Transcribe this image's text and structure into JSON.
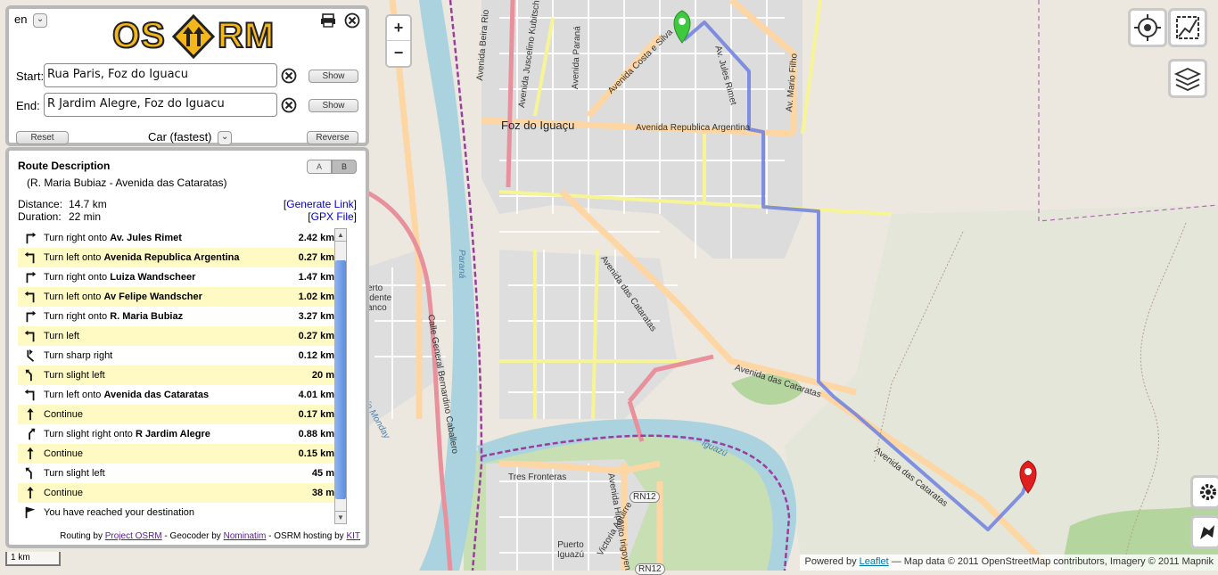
{
  "app": {
    "language": "en",
    "logo_left": "OS",
    "logo_right": "RM"
  },
  "form": {
    "start_label": "Start:",
    "start_value": "Rua Paris, Foz do Iguacu",
    "end_label": "End:",
    "end_value": "R Jardim Alegre, Foz do Iguacu",
    "show_label": "Show",
    "reset_label": "Reset",
    "mode_label": "Car (fastest)",
    "reverse_label": "Reverse"
  },
  "route": {
    "title": "Route Description",
    "from_to": "(R. Maria Bubiaz - Avenida das Cataratas)",
    "alt_a": "A",
    "alt_b": "B",
    "distance_label": "Distance:",
    "distance_value": "14.7 km",
    "duration_label": "Duration:",
    "duration_value": "22 min",
    "generate_link": "Generate Link",
    "gpx_file": "GPX File",
    "steps": [
      {
        "icon": "turn-right-icon",
        "text": "Turn right onto",
        "street": "Av. Jules Rimet",
        "dist": "2.42 km"
      },
      {
        "icon": "turn-left-icon",
        "text": "Turn left onto",
        "street": "Avenida Republica Argentina",
        "dist": "0.27 km"
      },
      {
        "icon": "turn-right-icon",
        "text": "Turn right onto",
        "street": "Luiza Wandscheer",
        "dist": "1.47 km"
      },
      {
        "icon": "turn-left-icon",
        "text": "Turn left onto",
        "street": "Av Felipe Wandscher",
        "dist": "1.02 km"
      },
      {
        "icon": "turn-right-icon",
        "text": "Turn right onto",
        "street": "R. Maria Bubiaz",
        "dist": "3.27 km"
      },
      {
        "icon": "turn-left-icon",
        "text": "Turn left",
        "street": "",
        "dist": "0.27 km"
      },
      {
        "icon": "sharp-right-icon",
        "text": "Turn sharp right",
        "street": "",
        "dist": "0.12 km"
      },
      {
        "icon": "slight-left-icon",
        "text": "Turn slight left",
        "street": "",
        "dist": "20 m"
      },
      {
        "icon": "turn-left-icon",
        "text": "Turn left onto",
        "street": "Avenida das Cataratas",
        "dist": "4.01 km"
      },
      {
        "icon": "continue-icon",
        "text": "Continue",
        "street": "",
        "dist": "0.17 km"
      },
      {
        "icon": "slight-right-icon",
        "text": "Turn slight right onto",
        "street": "R Jardim Alegre",
        "dist": "0.88 km"
      },
      {
        "icon": "continue-icon",
        "text": "Continue",
        "street": "",
        "dist": "0.15 km"
      },
      {
        "icon": "slight-left-icon",
        "text": "Turn slight left",
        "street": "",
        "dist": "45 m"
      },
      {
        "icon": "continue-icon",
        "text": "Continue",
        "street": "",
        "dist": "38 m"
      },
      {
        "icon": "destination-flag-icon",
        "text": "You have reached your destination",
        "street": "",
        "dist": ""
      }
    ],
    "footer_routing": "Routing by",
    "footer_routing_link": "Project OSRM",
    "footer_geocoder": " - Geocoder by",
    "footer_geocoder_link": "Nominatim",
    "footer_hosting": " - OSRM hosting by",
    "footer_hosting_link": "KIT"
  },
  "map": {
    "zoom_in": "+",
    "zoom_out": "−",
    "scale": "1 km",
    "labels": {
      "city": "Foz do Iguaçu",
      "av_rep_argentina": "Avenida Republica Argentina",
      "av_cataratas_1": "Avenida das Cataratas",
      "av_cataratas_2": "Avenida das Cataratas",
      "av_cataratas_3": "Avenida das Cataratas",
      "av_jules_rimet": "Av. Jules Rimet",
      "av_parana": "Avenida Paraná",
      "av_beira_rio": "Avenida Beira Rio",
      "av_costa_silva": "Avenida Costa e Silva",
      "av_mario_filho": "Av. Mario Filho",
      "av_kubitschek": "Avenida Juscelino Kubitschek",
      "tres_fronteras": "Tres Fronteras",
      "rn12": "RN12",
      "rn12b": "RN12",
      "puerto_iguazu": "Puerto Iguazú",
      "victoria_aguirre": "Victoria Aguirre",
      "hipolito_irigoyen": "Avenida Hipólito Irigoyen",
      "puerto_presidente": "erto idente anco",
      "bernardino": "Calle General Bernardino Caballero",
      "rio_monday": "Río Monday",
      "parana_river": "Paraná",
      "iguazu_river": "Iguazú"
    },
    "attribution_prefix": "Powered by",
    "attribution_link": "Leaflet",
    "attribution_rest": "— Map data © 2011 OpenStreetMap contributors, Imagery © 2011 Mapnik",
    "route_color": "#6f7fe0",
    "start_marker_color": "#3ec93e",
    "end_marker_color": "#e02020"
  }
}
